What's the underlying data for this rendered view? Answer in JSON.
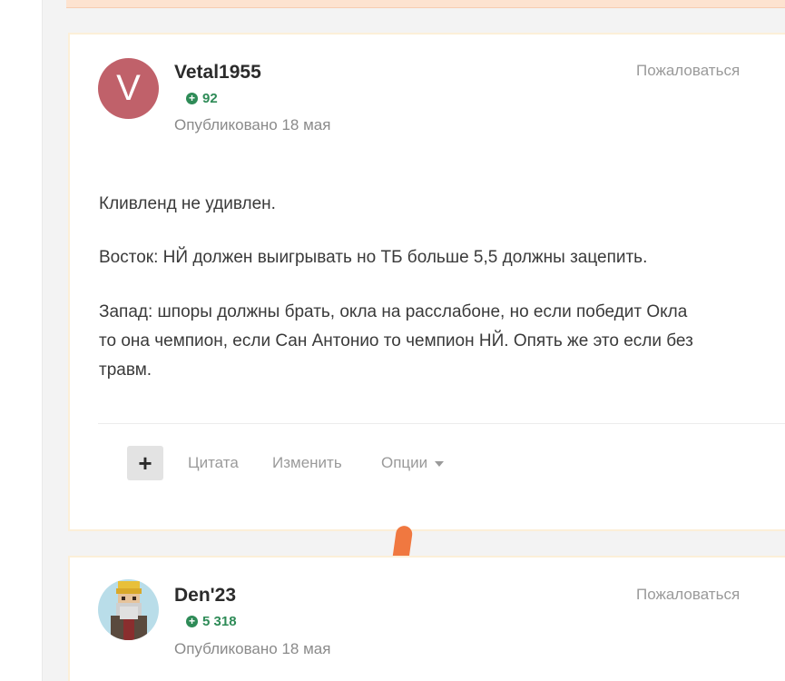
{
  "posts": [
    {
      "author": "Vetal1955",
      "avatar_letter": "V",
      "avatar_color": "#c0616a",
      "reputation": "92",
      "published": "Опубликовано 18 мая",
      "report_label": "Пожаловаться",
      "paragraphs": [
        "Кливленд не удивлен.",
        "Восток: НЙ должен выигрывать но ТБ больше 5,5 должны зацепить.",
        "Запад: шпоры должны брать, окла на расслабоне, но если победит Окла",
        "то она чемпион, если Сан Антонио то чемпион НЙ. Опять же это если без",
        "травм."
      ],
      "actions": {
        "plus": "+",
        "quote": "Цитата",
        "edit": "Изменить",
        "options": "Опции"
      }
    },
    {
      "author": "Den'23",
      "reputation": "5 318",
      "published": "Опубликовано 18 мая",
      "report_label": "Пожаловаться"
    }
  ],
  "icons": {
    "reputation": "plus-circle-icon",
    "options_caret": "caret-down-icon"
  },
  "colors": {
    "reputation": "#2e8b57",
    "accent_handle": "#f07840",
    "post_border": "#fcefd8"
  }
}
